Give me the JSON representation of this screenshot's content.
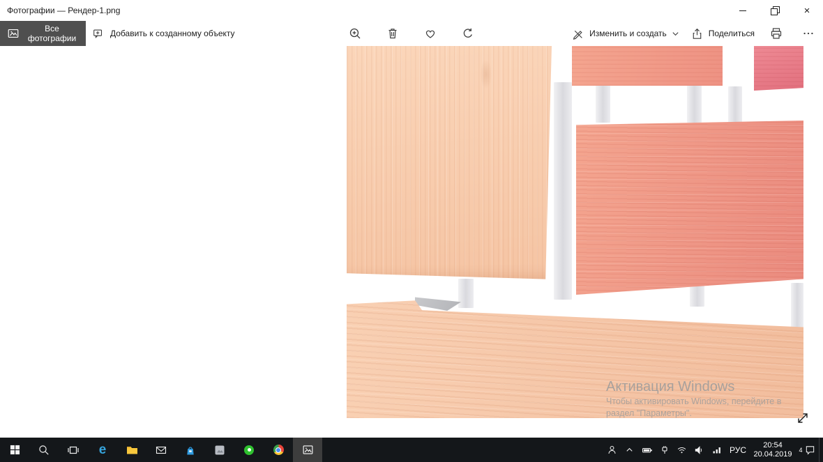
{
  "titlebar": {
    "title": "Фотографии — Рендер-1.png"
  },
  "toolbar": {
    "all_photos_label": "Все фотографии",
    "add_to_creation_label": "Добавить к созданному объекту",
    "edit_create_label": "Изменить и создать",
    "share_label": "Поделиться"
  },
  "viewer": {
    "watermark": {
      "title": "Активация Windows",
      "line1": "Чтобы активировать Windows, перейдите в",
      "line2": "раздел \"Параметры\"."
    }
  },
  "taskbar": {
    "pinned_apps": [
      "start",
      "search",
      "task-view",
      "edge",
      "file-explorer",
      "mail",
      "store",
      "app",
      "green-app",
      "chrome",
      "photos"
    ],
    "active_app": "photos",
    "language_label": "РУС",
    "clock": {
      "time": "20:54",
      "date": "20.04.2019"
    },
    "notification_badge": "4"
  },
  "icons": {
    "toolbar": [
      "photos-icon",
      "add-to-creation-icon",
      "zoom-in-icon",
      "delete-icon",
      "favorite-heart-icon",
      "rotate-icon",
      "edit-create-icon",
      "chevron-down-icon",
      "share-icon",
      "print-icon",
      "more-icon"
    ],
    "titlebar": [
      "minimize-icon",
      "restore-icon",
      "close-icon"
    ],
    "tray": [
      "people-icon",
      "chevron-up-icon",
      "battery-icon",
      "usb-icon",
      "wifi-icon",
      "speaker-icon",
      "signal-icon",
      "action-center-icon"
    ],
    "viewer": [
      "fullscreen-diagonal-arrow-icon"
    ]
  },
  "colors": {
    "peach1": "#fbd6ba",
    "peach2": "#f5c4a3",
    "salmon1": "#f4a58f",
    "salmon2": "#ee9283",
    "salmon3": "#ea8a7e",
    "pink1": "#ee8a94",
    "pink2": "#e2707e",
    "plank1": "#f9d0b3",
    "plank2": "#f2bd9d",
    "toolbarBtn": "#4f4f4f",
    "taskbarBg": "#14171a",
    "activeApp": "#3d3d3d",
    "edgeBlue": "#36a4dc",
    "folderYellow": "#f8c73c",
    "storeBlue": "#2f9be0",
    "greenApp": "#2fc12f",
    "watermarkGray": "#9b9b9b"
  }
}
